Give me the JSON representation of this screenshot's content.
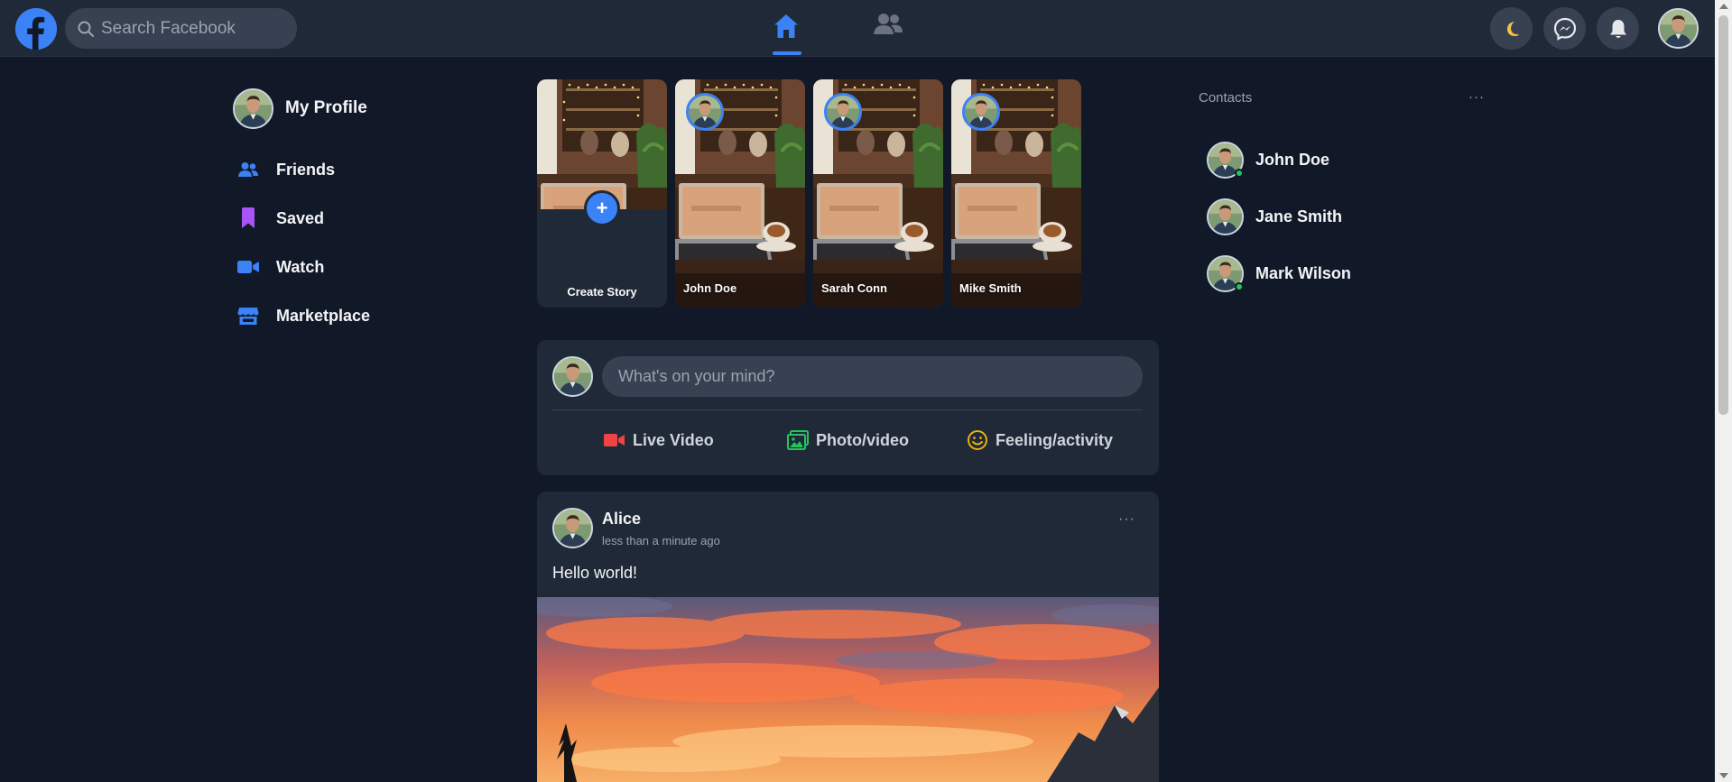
{
  "topbar": {
    "logo_icon": "facebook-logo-icon",
    "search": {
      "placeholder": "Search Facebook",
      "value": ""
    },
    "nav": [
      {
        "icon": "home-icon",
        "active": true
      },
      {
        "icon": "friends-icon",
        "active": false
      }
    ],
    "buttons": [
      {
        "icon": "moon-icon"
      },
      {
        "icon": "messenger-icon"
      },
      {
        "icon": "bell-icon"
      }
    ],
    "accent_color": "#3b82f6"
  },
  "sidebar": {
    "profile_label": "My Profile",
    "items": [
      {
        "label": "Friends",
        "icon": "friends-icon",
        "color": "#3b82f6"
      },
      {
        "label": "Saved",
        "icon": "bookmark-icon",
        "color": "#a855f7"
      },
      {
        "label": "Watch",
        "icon": "video-icon",
        "color": "#3b82f6"
      },
      {
        "label": "Marketplace",
        "icon": "store-icon",
        "color": "#3b82f6"
      }
    ]
  },
  "stories": {
    "create": {
      "label": "Create Story",
      "plus": "+"
    },
    "items": [
      {
        "name": "John Doe"
      },
      {
        "name": "Sarah Conn"
      },
      {
        "name": "Mike Smith"
      }
    ]
  },
  "composer": {
    "placeholder": "What's on your mind?",
    "actions": [
      {
        "label": "Live Video",
        "icon": "live-video-icon",
        "color": "#ef4444"
      },
      {
        "label": "Photo/video",
        "icon": "photo-icon",
        "color": "#22c55e"
      },
      {
        "label": "Feeling/activity",
        "icon": "smiley-icon",
        "color": "#eab308"
      }
    ]
  },
  "post": {
    "author": "Alice",
    "time": "less than a minute ago",
    "more": "···",
    "text": "Hello world!"
  },
  "contacts": {
    "title": "Contacts",
    "more": "···",
    "items": [
      {
        "name": "John Doe",
        "online": true
      },
      {
        "name": "Jane Smith",
        "online": false
      },
      {
        "name": "Mark Wilson",
        "online": true
      }
    ],
    "online_color": "#22c55e"
  }
}
